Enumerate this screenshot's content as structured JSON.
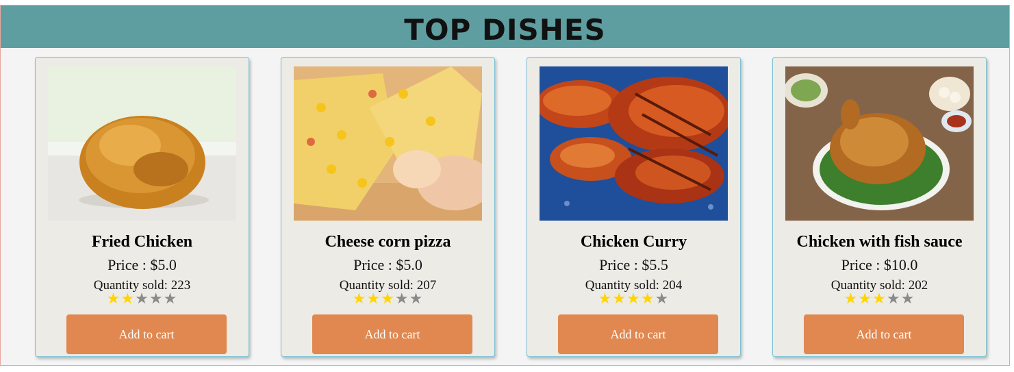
{
  "header": {
    "title": "TOP DISHES"
  },
  "colors": {
    "header_bg": "#5f9ea0",
    "card_bg": "#ecebe6",
    "button_bg": "#e08850",
    "star_on": "#ffd400",
    "star_off": "#8a8a8a"
  },
  "dishes": [
    {
      "name": "Fried Chicken",
      "price": "Price : $5.0",
      "sold": "Quantity sold: 223",
      "rating": 2,
      "button": "Add to cart",
      "image_icon": "fried-chicken-photo"
    },
    {
      "name": "Cheese corn pizza",
      "price": "Price : $5.0",
      "sold": "Quantity sold: 207",
      "rating": 3,
      "button": "Add to cart",
      "image_icon": "pizza-photo"
    },
    {
      "name": "Chicken Curry",
      "price": "Price : $5.5",
      "sold": "Quantity sold: 204",
      "rating": 4,
      "button": "Add to cart",
      "image_icon": "grilled-chicken-photo"
    },
    {
      "name": "Chicken with fish sauce",
      "price": "Price : $10.0",
      "sold": "Quantity sold: 202",
      "rating": 3,
      "button": "Add to cart",
      "image_icon": "roast-chicken-photo"
    }
  ]
}
